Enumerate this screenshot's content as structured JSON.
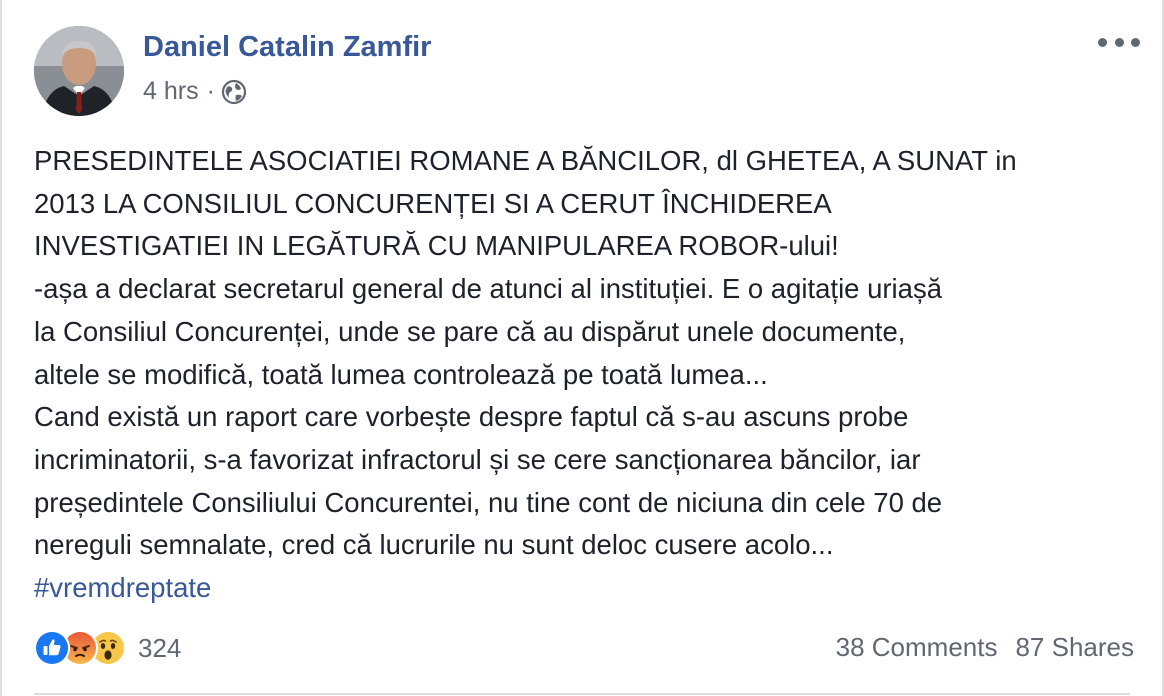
{
  "post": {
    "author": "Daniel Catalin Zamfir",
    "time": "4 hrs",
    "separator": "·",
    "privacy_icon": "globe-icon",
    "menu_icon": "more-options-icon",
    "lines": [
      "PRESEDINTELE ASOCIATIEI ROMANE A BĂNCILOR, dl GHETEA, A SUNAT in",
      "2013 LA CONSILIUL CONCURENȚEI SI A CERUT ÎNCHIDEREA",
      "INVESTIGATIEI IN LEGĂTURĂ CU MANIPULAREA ROBOR-ului!",
      "-așa a declarat secretarul general de atunci al instituției. E o agitație uriașă",
      "la Consiliul Concurenței, unde se pare că au dispărut unele documente,",
      "altele se modifică, toată lumea controlează pe toată lumea...",
      "Cand există un raport care vorbește despre faptul că s-au ascuns probe",
      "incriminatorii, s-a favorizat infractorul și se cere sancționarea băncilor, iar",
      "președintele Consiliului Concurentei, nu tine cont de niciuna din cele 70 de",
      "nereguli semnalate, cred că lucrurile nu sunt deloc cusere acolo..."
    ],
    "hashtag": "#vremdreptate"
  },
  "footer": {
    "reaction_icons": [
      "like-icon",
      "angry-icon",
      "wow-icon"
    ],
    "reaction_count": "324",
    "comments": "38 Comments",
    "shares": "87 Shares"
  },
  "colors": {
    "link": "#385898",
    "text": "#1d2129",
    "muted": "#616770",
    "like": "#1877f2",
    "angry": "#f0663a",
    "wow": "#f7c64a"
  }
}
